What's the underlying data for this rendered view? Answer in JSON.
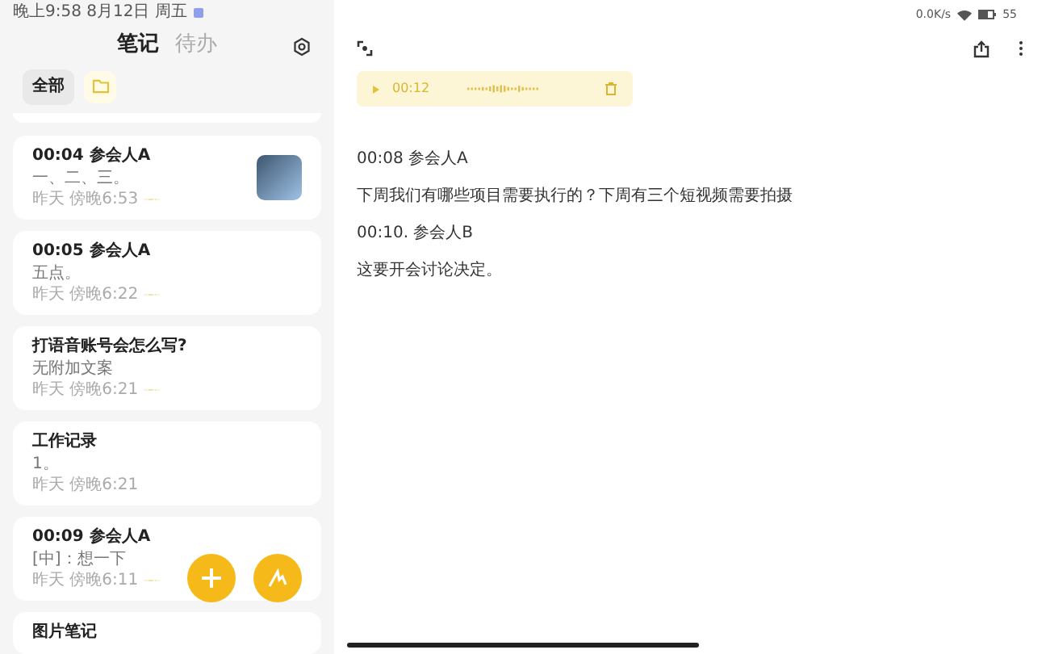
{
  "status_bar": {
    "time": "晚上9:58 8月12日 周五",
    "network": "0.0K/s",
    "battery": "55"
  },
  "tabs": [
    {
      "label": "笔记",
      "selected": true
    },
    {
      "label": "待办",
      "selected": false
    }
  ],
  "filters": [
    {
      "label": "全部",
      "selected": true
    }
  ],
  "notes": [
    {
      "title": "00:04 参会人A",
      "subtitle": "一、二、三。",
      "meta": "昨天 傍晚6:53",
      "audio": true,
      "photo": true
    },
    {
      "title": "00:05 参会人A",
      "subtitle": "五点。",
      "meta": "昨天 傍晚6:22",
      "audio": true,
      "photo": false
    },
    {
      "title": "打语音账号会怎么写?",
      "subtitle": "无附加文案",
      "meta": "昨天 傍晚6:21",
      "audio": true,
      "photo": false
    },
    {
      "title": "工作记录",
      "subtitle": "1。",
      "meta": "昨天 傍晚6:21",
      "audio": false,
      "photo": false
    },
    {
      "title": "00:09 参会人A",
      "subtitle": "[中]：想一下",
      "meta": "昨天 傍晚6:11",
      "audio": true,
      "photo": false
    },
    {
      "title": "图片笔记",
      "photo": false
    }
  ],
  "player": {
    "time": "00:12"
  },
  "content": [
    "00:08 参会人A",
    "下周我们有哪些项目需要执行的？下周有三个短视频需要拍摄",
    "00:10. 参会人B",
    "这要开会讨论决定。"
  ]
}
